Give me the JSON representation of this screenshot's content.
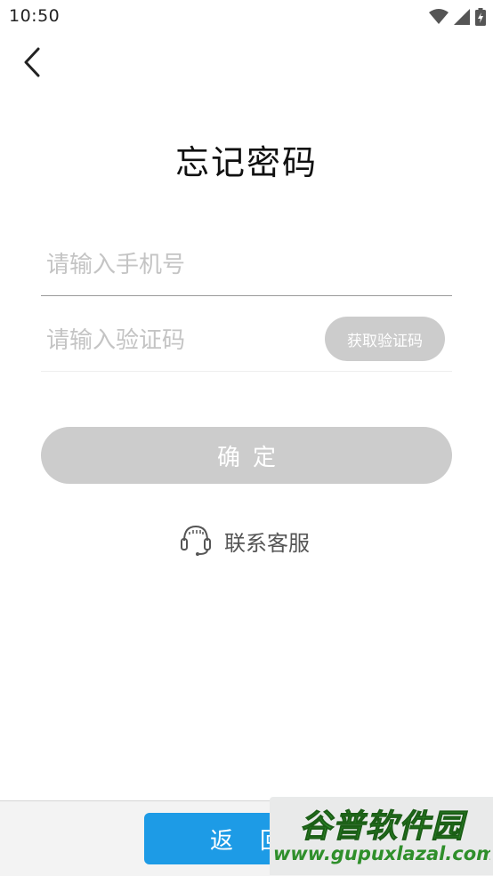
{
  "status_bar": {
    "time": "10:50",
    "icons": [
      "wifi-icon",
      "cell-signal-icon",
      "battery-charging-icon"
    ]
  },
  "header": {
    "back_icon": "chevron-left-icon",
    "title": "忘记密码"
  },
  "form": {
    "phone": {
      "value": "",
      "placeholder": "请输入手机号"
    },
    "code": {
      "value": "",
      "placeholder": "请输入验证码"
    },
    "get_code_label": "获取验证码",
    "confirm_label": "确定"
  },
  "support": {
    "icon": "headset-icon",
    "label": "联系客服"
  },
  "bottom_bar": {
    "back_label": "返回"
  },
  "watermark": {
    "title": "谷普软件园",
    "url": "www.gupuxlazal.com"
  },
  "colors": {
    "primary": "#1d9be6",
    "disabled": "#cccccc",
    "placeholder": "#c4c4c4",
    "watermark_green": "#2f8f2b"
  }
}
